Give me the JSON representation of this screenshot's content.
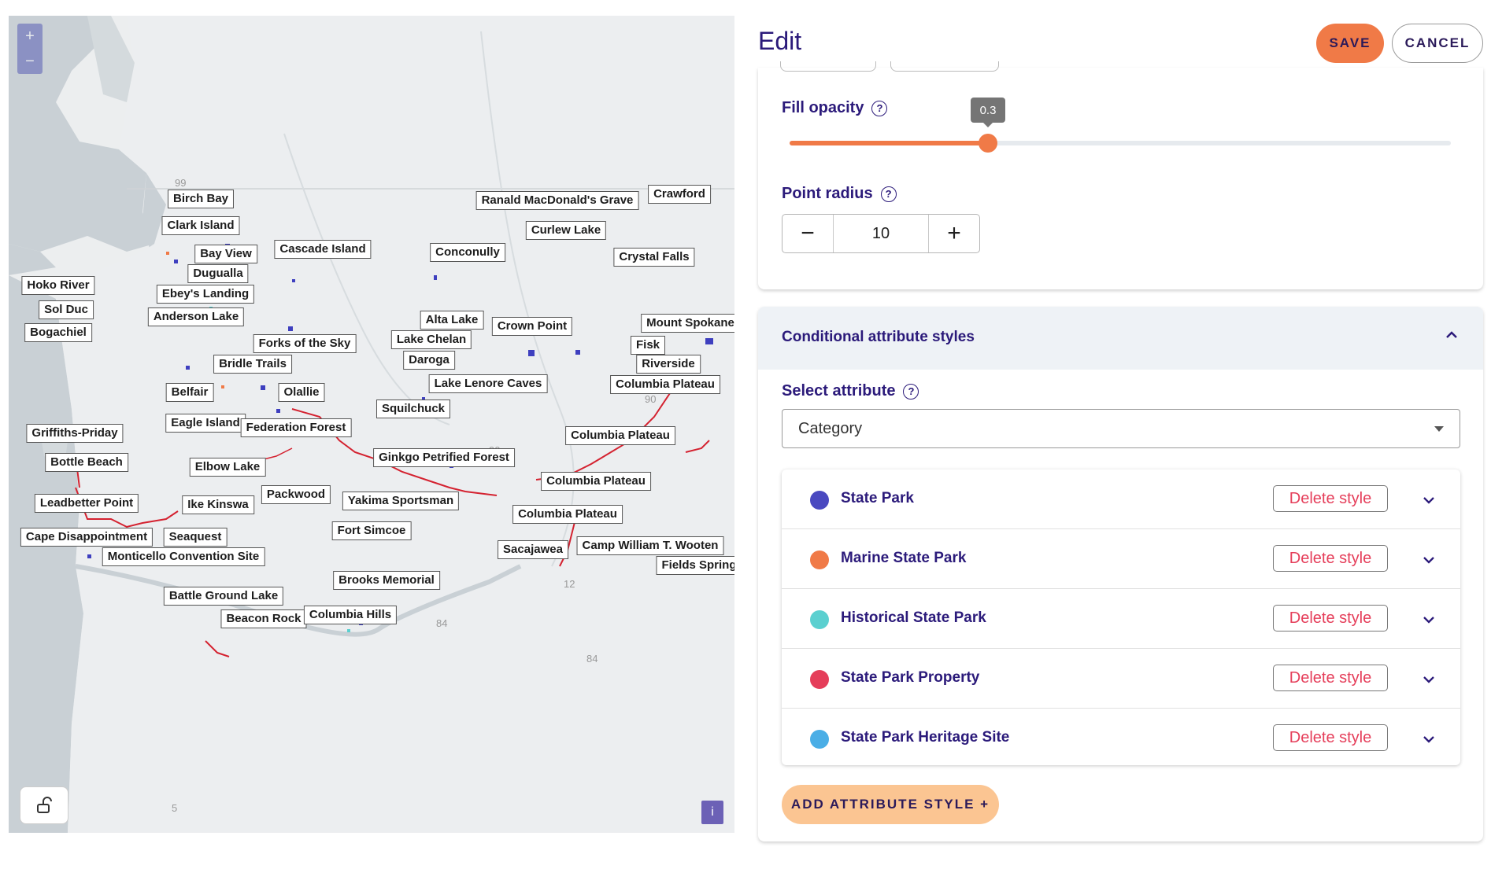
{
  "header": {
    "title": "Edit",
    "save_label": "SAVE",
    "cancel_label": "CANCEL"
  },
  "fill_opacity": {
    "label": "Fill opacity",
    "value": "0.3",
    "fraction": 0.3
  },
  "point_radius": {
    "label": "Point radius",
    "value": "10",
    "minus": "−",
    "plus": "+"
  },
  "conditional": {
    "title": "Conditional attribute styles",
    "select_label": "Select attribute",
    "selected_attribute": "Category",
    "styles": [
      {
        "name": "State Park",
        "color": "#4a49c0",
        "delete_label": "Delete style"
      },
      {
        "name": "Marine State Park",
        "color": "#f07a47",
        "delete_label": "Delete style"
      },
      {
        "name": "Historical State Park",
        "color": "#5bd0d0",
        "delete_label": "Delete style"
      },
      {
        "name": "State Park Property",
        "color": "#e53e5a",
        "delete_label": "Delete style"
      },
      {
        "name": "State Park Heritage Site",
        "color": "#4aaee6",
        "delete_label": "Delete style"
      }
    ],
    "add_label": "ADD ATTRIBUTE STYLE  +"
  },
  "map": {
    "zoom_in": "+",
    "zoom_out": "−",
    "info": "i",
    "road_numbers": [
      "99",
      "90",
      "90",
      "12",
      "84",
      "84",
      "5"
    ],
    "labels": [
      "Birch Bay",
      "Clark Island",
      "Bay View",
      "Cascade Island",
      "Dugualla",
      "Hoko River",
      "Ebey's Landing",
      "Sol Duc",
      "Anderson Lake",
      "Bogachiel",
      "Forks of the Sky",
      "Bridle Trails",
      "Belfair",
      "Olallie",
      "Eagle Island",
      "Federation Forest",
      "Griffiths-Priday",
      "Bottle Beach",
      "Elbow Lake",
      "Leadbetter Point",
      "Ike Kinswa",
      "Packwood",
      "Cape Disappointment",
      "Seaquest",
      "Monticello Convention Site",
      "Battle Ground Lake",
      "Beacon Rock",
      "Columbia Hills",
      "Brooks Memorial",
      "Fort Simcoe",
      "Yakima Sportsman",
      "Ginkgo Petrified Forest",
      "Squilchuck",
      "Lake Lenore Caves",
      "Daroga",
      "Lake Chelan",
      "Alta Lake",
      "Conconully",
      "Crown Point",
      "Ranald MacDonald's Grave",
      "Curlew Lake",
      "Crawford",
      "Crystal Falls",
      "Mount Spokane",
      "Fisk",
      "Riverside",
      "Columbia Plateau",
      "Columbia Plateau",
      "Columbia Plateau",
      "Columbia Plateau",
      "Sacajawea",
      "Camp William T. Wooten",
      "Fields Spring"
    ]
  }
}
